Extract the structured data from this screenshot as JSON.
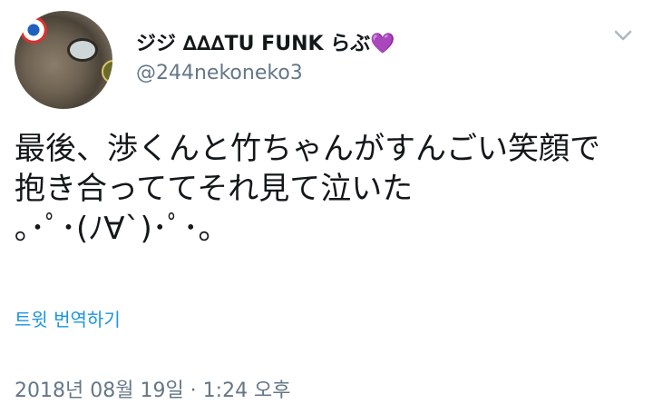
{
  "user": {
    "display_name": "ジジ ∆∆∆TU FUNK らぶ",
    "name_emoji": "💜",
    "handle": "@244nekoneko3"
  },
  "menu_icon": "chevron-down-icon",
  "tweet": {
    "lines": [
      "最後、渉くんと竹ちゃんがすんごい笑顔で",
      "抱き合っててそれ見て泣いた",
      "｡･ﾟ･(ﾉ∀`)･ﾟ･｡"
    ],
    "translate_label": "트윗 번역하기",
    "timestamp": "2018년 08월 19일 · 1:24 오후"
  },
  "colors": {
    "text": "#14171a",
    "secondary": "#657786",
    "link": "#1b95e0",
    "heart": "#7b2fbe"
  }
}
